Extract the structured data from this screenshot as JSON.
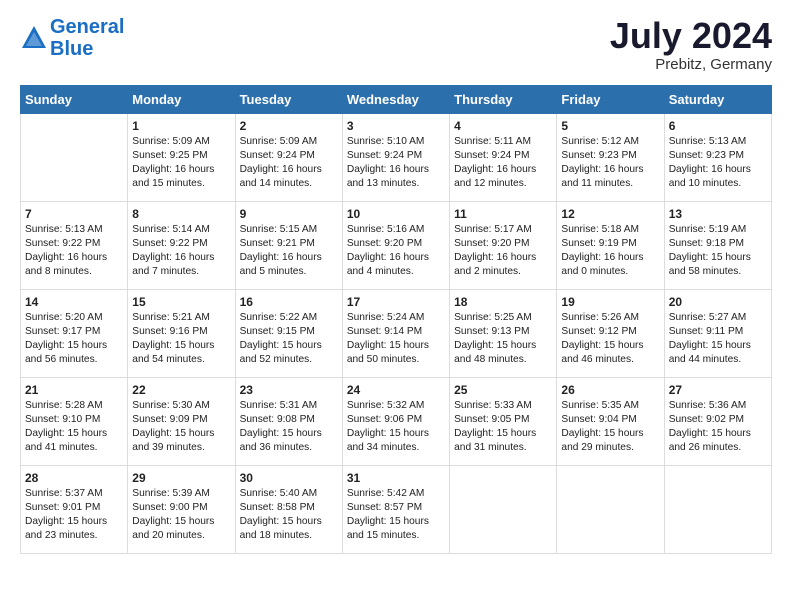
{
  "header": {
    "logo_line1": "General",
    "logo_line2": "Blue",
    "month_year": "July 2024",
    "location": "Prebitz, Germany"
  },
  "weekdays": [
    "Sunday",
    "Monday",
    "Tuesday",
    "Wednesday",
    "Thursday",
    "Friday",
    "Saturday"
  ],
  "weeks": [
    [
      {
        "day": "",
        "info": ""
      },
      {
        "day": "1",
        "info": "Sunrise: 5:09 AM\nSunset: 9:25 PM\nDaylight: 16 hours\nand 15 minutes."
      },
      {
        "day": "2",
        "info": "Sunrise: 5:09 AM\nSunset: 9:24 PM\nDaylight: 16 hours\nand 14 minutes."
      },
      {
        "day": "3",
        "info": "Sunrise: 5:10 AM\nSunset: 9:24 PM\nDaylight: 16 hours\nand 13 minutes."
      },
      {
        "day": "4",
        "info": "Sunrise: 5:11 AM\nSunset: 9:24 PM\nDaylight: 16 hours\nand 12 minutes."
      },
      {
        "day": "5",
        "info": "Sunrise: 5:12 AM\nSunset: 9:23 PM\nDaylight: 16 hours\nand 11 minutes."
      },
      {
        "day": "6",
        "info": "Sunrise: 5:13 AM\nSunset: 9:23 PM\nDaylight: 16 hours\nand 10 minutes."
      }
    ],
    [
      {
        "day": "7",
        "info": "Sunrise: 5:13 AM\nSunset: 9:22 PM\nDaylight: 16 hours\nand 8 minutes."
      },
      {
        "day": "8",
        "info": "Sunrise: 5:14 AM\nSunset: 9:22 PM\nDaylight: 16 hours\nand 7 minutes."
      },
      {
        "day": "9",
        "info": "Sunrise: 5:15 AM\nSunset: 9:21 PM\nDaylight: 16 hours\nand 5 minutes."
      },
      {
        "day": "10",
        "info": "Sunrise: 5:16 AM\nSunset: 9:20 PM\nDaylight: 16 hours\nand 4 minutes."
      },
      {
        "day": "11",
        "info": "Sunrise: 5:17 AM\nSunset: 9:20 PM\nDaylight: 16 hours\nand 2 minutes."
      },
      {
        "day": "12",
        "info": "Sunrise: 5:18 AM\nSunset: 9:19 PM\nDaylight: 16 hours\nand 0 minutes."
      },
      {
        "day": "13",
        "info": "Sunrise: 5:19 AM\nSunset: 9:18 PM\nDaylight: 15 hours\nand 58 minutes."
      }
    ],
    [
      {
        "day": "14",
        "info": "Sunrise: 5:20 AM\nSunset: 9:17 PM\nDaylight: 15 hours\nand 56 minutes."
      },
      {
        "day": "15",
        "info": "Sunrise: 5:21 AM\nSunset: 9:16 PM\nDaylight: 15 hours\nand 54 minutes."
      },
      {
        "day": "16",
        "info": "Sunrise: 5:22 AM\nSunset: 9:15 PM\nDaylight: 15 hours\nand 52 minutes."
      },
      {
        "day": "17",
        "info": "Sunrise: 5:24 AM\nSunset: 9:14 PM\nDaylight: 15 hours\nand 50 minutes."
      },
      {
        "day": "18",
        "info": "Sunrise: 5:25 AM\nSunset: 9:13 PM\nDaylight: 15 hours\nand 48 minutes."
      },
      {
        "day": "19",
        "info": "Sunrise: 5:26 AM\nSunset: 9:12 PM\nDaylight: 15 hours\nand 46 minutes."
      },
      {
        "day": "20",
        "info": "Sunrise: 5:27 AM\nSunset: 9:11 PM\nDaylight: 15 hours\nand 44 minutes."
      }
    ],
    [
      {
        "day": "21",
        "info": "Sunrise: 5:28 AM\nSunset: 9:10 PM\nDaylight: 15 hours\nand 41 minutes."
      },
      {
        "day": "22",
        "info": "Sunrise: 5:30 AM\nSunset: 9:09 PM\nDaylight: 15 hours\nand 39 minutes."
      },
      {
        "day": "23",
        "info": "Sunrise: 5:31 AM\nSunset: 9:08 PM\nDaylight: 15 hours\nand 36 minutes."
      },
      {
        "day": "24",
        "info": "Sunrise: 5:32 AM\nSunset: 9:06 PM\nDaylight: 15 hours\nand 34 minutes."
      },
      {
        "day": "25",
        "info": "Sunrise: 5:33 AM\nSunset: 9:05 PM\nDaylight: 15 hours\nand 31 minutes."
      },
      {
        "day": "26",
        "info": "Sunrise: 5:35 AM\nSunset: 9:04 PM\nDaylight: 15 hours\nand 29 minutes."
      },
      {
        "day": "27",
        "info": "Sunrise: 5:36 AM\nSunset: 9:02 PM\nDaylight: 15 hours\nand 26 minutes."
      }
    ],
    [
      {
        "day": "28",
        "info": "Sunrise: 5:37 AM\nSunset: 9:01 PM\nDaylight: 15 hours\nand 23 minutes."
      },
      {
        "day": "29",
        "info": "Sunrise: 5:39 AM\nSunset: 9:00 PM\nDaylight: 15 hours\nand 20 minutes."
      },
      {
        "day": "30",
        "info": "Sunrise: 5:40 AM\nSunset: 8:58 PM\nDaylight: 15 hours\nand 18 minutes."
      },
      {
        "day": "31",
        "info": "Sunrise: 5:42 AM\nSunset: 8:57 PM\nDaylight: 15 hours\nand 15 minutes."
      },
      {
        "day": "",
        "info": ""
      },
      {
        "day": "",
        "info": ""
      },
      {
        "day": "",
        "info": ""
      }
    ]
  ]
}
